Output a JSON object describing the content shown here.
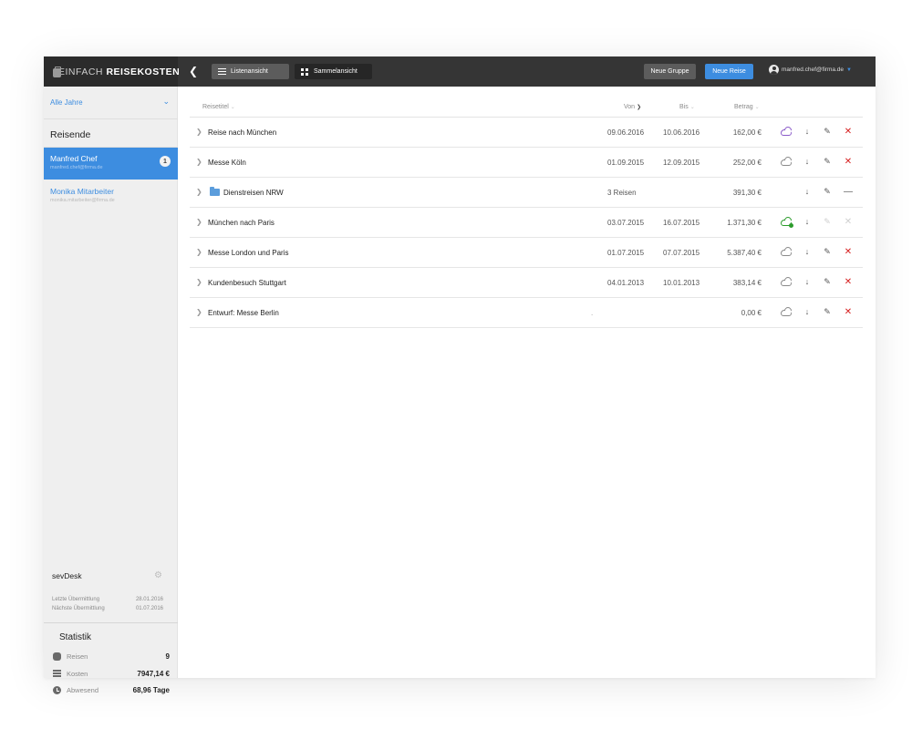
{
  "app": {
    "brand_prefix": "EINFACH ",
    "brand_bold": "REISEKOSTEN"
  },
  "topbar": {
    "back_icon": "chevron-left-icon",
    "view_list_label": "Listenansicht",
    "view_collect_label": "Sammelansicht",
    "new_group_label": "Neue Gruppe",
    "new_trip_label": "Neue Reise",
    "user_email": "manfred.chef@firma.de",
    "accent_color": "#3d8de0"
  },
  "sidebar": {
    "year_filter": "Alle Jahre",
    "section_title": "Reisende",
    "travelers": [
      {
        "name": "Manfred Chef",
        "email": "manfred.chef@firma.de",
        "badge": "1",
        "active": true
      },
      {
        "name": "Monika Mitarbeiter",
        "email": "monika.mitarbeiter@firma.de",
        "badge": "",
        "active": false
      }
    ],
    "sevdesk": {
      "title": "sevDesk",
      "last_label": "Letzte Übermittlung",
      "last_value": "28.01.2016",
      "next_label": "Nächste Übermittlung",
      "next_value": "01.07.2016"
    },
    "stats": {
      "title": "Statistik",
      "trips_label": "Reisen",
      "trips_value": "9",
      "costs_label": "Kosten",
      "costs_value": "7947,14 €",
      "absent_label": "Abwesend",
      "absent_value": "68,96 Tage"
    }
  },
  "table": {
    "headers": {
      "title": "Reisetitel",
      "from": "Von",
      "to": "Bis",
      "amount": "Betrag"
    },
    "rows": [
      {
        "title": "Reise nach München",
        "from": "09.06.2016",
        "to": "10.06.2016",
        "amount": "162,00 €",
        "cloud": "purple",
        "folder": false,
        "delete": "x"
      },
      {
        "title": "Messe Köln",
        "from": "01.09.2015",
        "to": "12.09.2015",
        "amount": "252,00 €",
        "cloud": "gray",
        "folder": false,
        "delete": "x"
      },
      {
        "title": "Dienstreisen NRW",
        "from": "3 Reisen",
        "to": "",
        "amount": "391,30 €",
        "cloud": "none",
        "folder": true,
        "delete": "dash"
      },
      {
        "title": "München nach Paris",
        "from": "03.07.2015",
        "to": "16.07.2015",
        "amount": "1.371,30 €",
        "cloud": "green",
        "folder": false,
        "delete": "disabled"
      },
      {
        "title": "Messe London und Paris",
        "from": "01.07.2015",
        "to": "07.07.2015",
        "amount": "5.387,40 €",
        "cloud": "gray",
        "folder": false,
        "delete": "x"
      },
      {
        "title": "Kundenbesuch Stuttgart",
        "from": "04.01.2013",
        "to": "10.01.2013",
        "amount": "383,14 €",
        "cloud": "gray",
        "folder": false,
        "delete": "x"
      },
      {
        "title": "Entwurf: Messe Berlin",
        "from": ".",
        "to": "",
        "amount": "0,00 €",
        "cloud": "gray",
        "folder": false,
        "delete": "x"
      }
    ]
  }
}
